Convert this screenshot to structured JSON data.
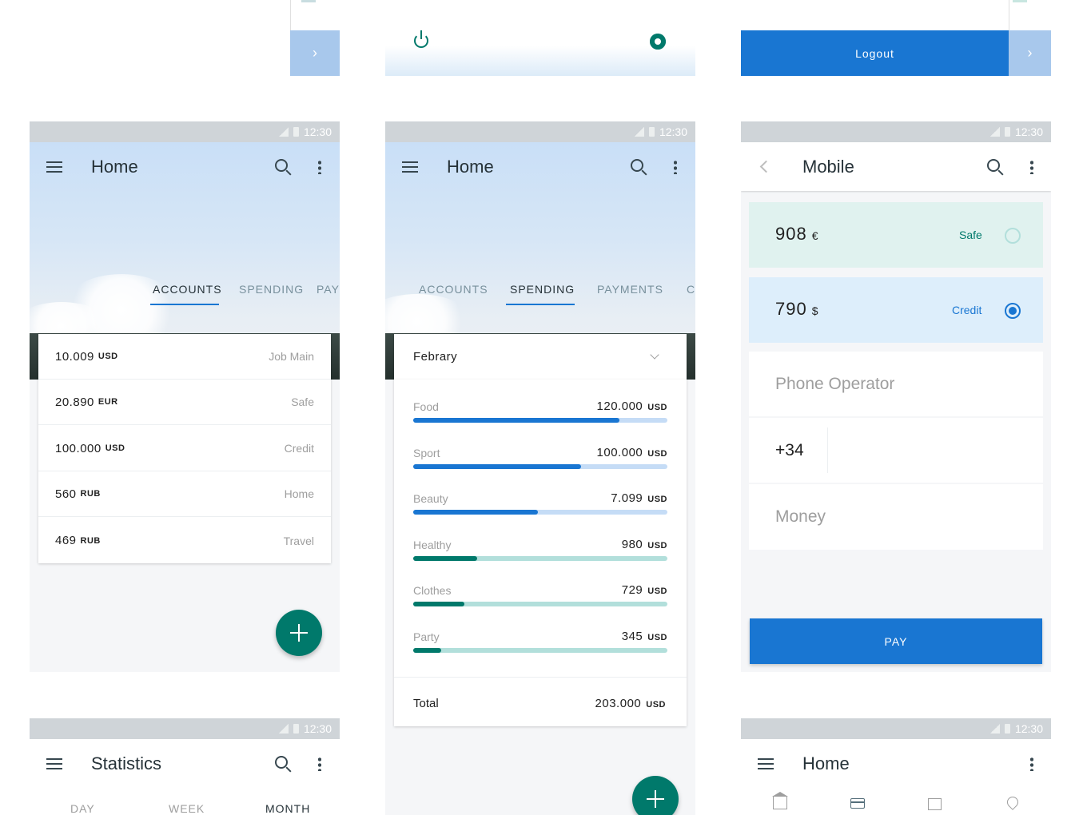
{
  "status_time": "12:30",
  "top": {
    "logout_label": "Logout",
    "chevron": "›"
  },
  "screen_accounts": {
    "title": "Home",
    "tabs": [
      "ACCOUNTS",
      "SPENDING",
      "PAY"
    ],
    "rows": [
      {
        "amount": "10.009",
        "currency": "USD",
        "label": "Job Main"
      },
      {
        "amount": "20.890",
        "currency": "EUR",
        "label": "Safe"
      },
      {
        "amount": "100.000",
        "currency": "USD",
        "label": "Credit"
      },
      {
        "amount": "560",
        "currency": "RUB",
        "label": "Home"
      },
      {
        "amount": "469",
        "currency": "RUB",
        "label": "Travel"
      }
    ]
  },
  "screen_spending": {
    "title": "Home",
    "tabs": [
      "ACCOUNTS",
      "SPENDING",
      "PAYMENTS",
      "C"
    ],
    "month": "Febrary",
    "items": [
      {
        "name": "Food",
        "value": "120.000",
        "currency": "USD",
        "fill": 0.81,
        "color": "#1976d2",
        "track": "#c5dcf6"
      },
      {
        "name": "Sport",
        "value": "100.000",
        "currency": "USD",
        "fill": 0.66,
        "color": "#1976d2",
        "track": "#c5dcf6"
      },
      {
        "name": "Beauty",
        "value": "7.099",
        "currency": "USD",
        "fill": 0.49,
        "color": "#1976d2",
        "track": "#c5dcf6"
      },
      {
        "name": "Healthy",
        "value": "980",
        "currency": "USD",
        "fill": 0.25,
        "color": "#00796b",
        "track": "#b2dfdb"
      },
      {
        "name": "Clothes",
        "value": "729",
        "currency": "USD",
        "fill": 0.2,
        "color": "#00796b",
        "track": "#b2dfdb"
      },
      {
        "name": "Party",
        "value": "345",
        "currency": "USD",
        "fill": 0.11,
        "color": "#00796b",
        "track": "#b2dfdb"
      }
    ],
    "total_label": "Total",
    "total_value": "203.000",
    "total_currency": "USD"
  },
  "screen_mobile": {
    "title": "Mobile",
    "accounts": [
      {
        "amount": "908",
        "currency": "€",
        "label": "Safe",
        "selected": false
      },
      {
        "amount": "790",
        "currency": "$",
        "label": "Credit",
        "selected": true
      }
    ],
    "operator_placeholder": "Phone Operator",
    "phone_prefix": "+34",
    "money_placeholder": "Money",
    "pay_label": "PAY"
  },
  "screen_statistics": {
    "title": "Statistics",
    "tabs": [
      "DAY",
      "WEEK",
      "MONTH"
    ]
  },
  "screen_home2": {
    "title": "Home",
    "bottom_icons": [
      "bank-icon",
      "card-icon",
      "bag-icon",
      "location-icon"
    ]
  },
  "colors": {
    "primary": "#1976d2",
    "teal": "#00796b",
    "statusbar": "#cfd4d8"
  }
}
